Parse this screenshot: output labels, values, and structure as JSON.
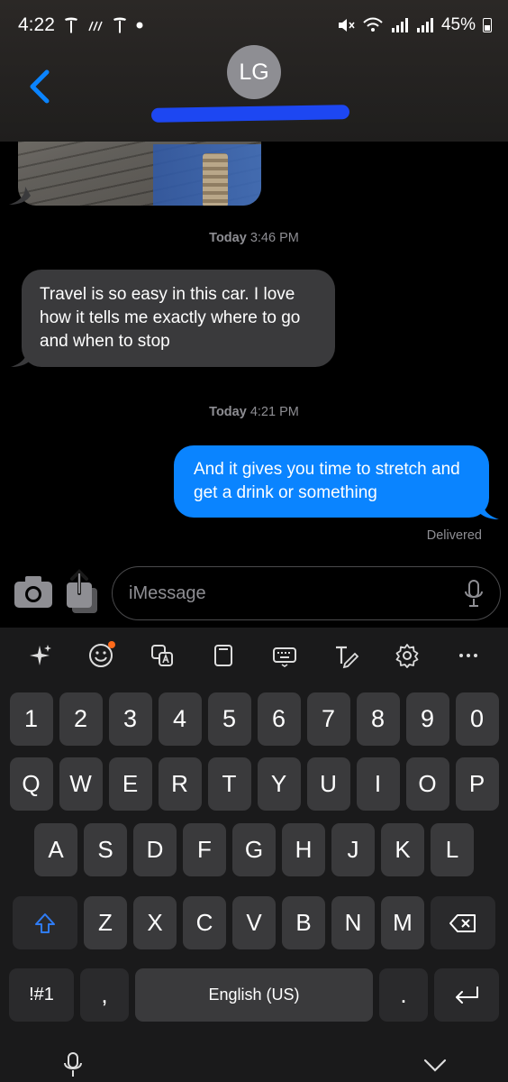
{
  "status_bar": {
    "time": "4:22",
    "battery": "45%"
  },
  "header": {
    "avatar_initials": "LG"
  },
  "messages": [
    {
      "type": "timestamp",
      "day": "Today",
      "time": "3:46 PM"
    },
    {
      "type": "incoming",
      "text": "Travel is so easy in this car. I love how it tells me exactly where to go and when to stop"
    },
    {
      "type": "timestamp",
      "day": "Today",
      "time": "4:21 PM"
    },
    {
      "type": "outgoing",
      "text": "And it gives you time to stretch and get a drink or something"
    }
  ],
  "delivered_label": "Delivered",
  "input": {
    "placeholder": "iMessage"
  },
  "keyboard": {
    "number_row": [
      "1",
      "2",
      "3",
      "4",
      "5",
      "6",
      "7",
      "8",
      "9",
      "0"
    ],
    "row1": [
      "Q",
      "W",
      "E",
      "R",
      "T",
      "Y",
      "U",
      "I",
      "O",
      "P"
    ],
    "row2": [
      "A",
      "S",
      "D",
      "F",
      "G",
      "H",
      "J",
      "K",
      "L"
    ],
    "row3": [
      "Z",
      "X",
      "C",
      "V",
      "B",
      "N",
      "M"
    ],
    "symbols_key": "!#1",
    "comma_key": ",",
    "space_label": "English (US)",
    "period_key": "."
  },
  "toolbar_icons": [
    "sparkle-icon",
    "emoji-icon",
    "translate-icon",
    "clipboard-icon",
    "keyboard-icon",
    "text-edit-icon",
    "settings-icon",
    "more-icon"
  ],
  "colors": {
    "outgoing_bubble": "#0a84ff",
    "incoming_bubble": "#3a3a3c",
    "accent_back": "#0a84ff",
    "badge": "#ff6a1a"
  }
}
